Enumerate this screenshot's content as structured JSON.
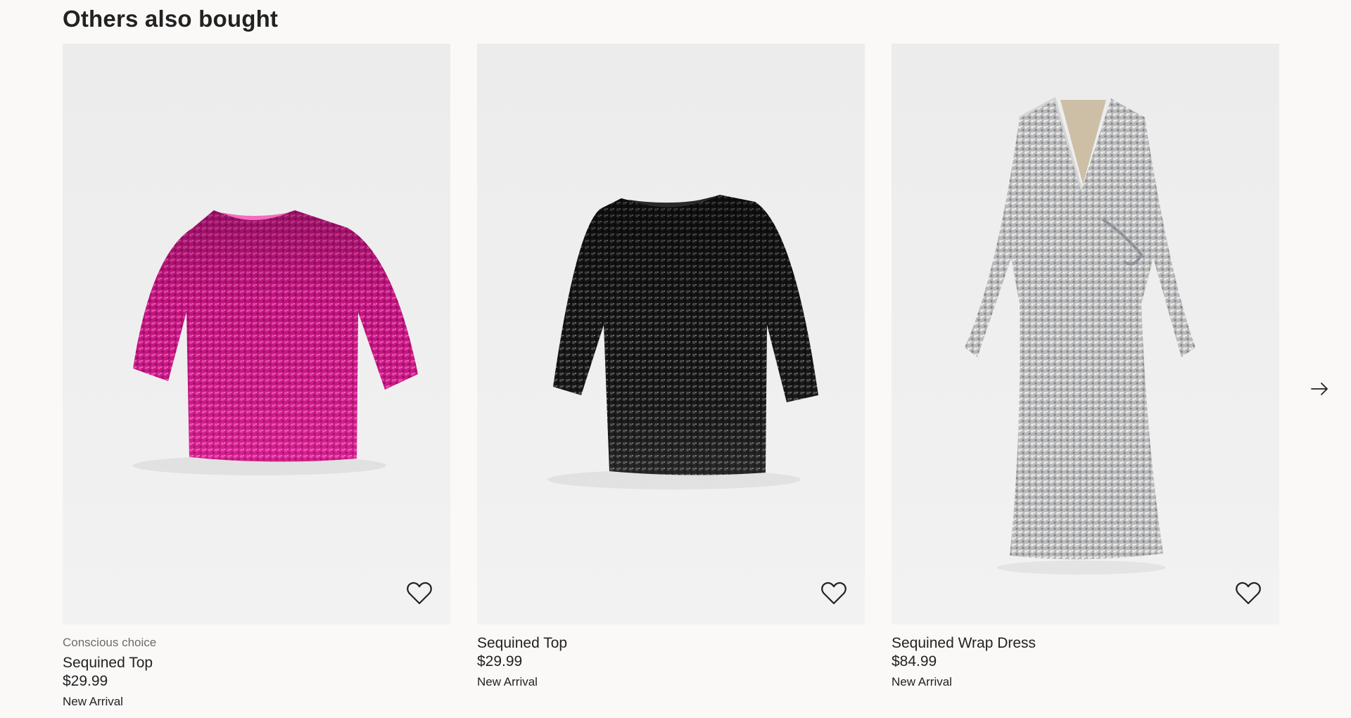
{
  "section": {
    "title": "Others also bought"
  },
  "products": [
    {
      "tag": "Conscious choice",
      "name": "Sequined Top",
      "price": "$29.99",
      "badge": "New Arrival",
      "color": "#d21a8c"
    },
    {
      "tag": "",
      "name": "Sequined Top",
      "price": "$29.99",
      "badge": "New Arrival",
      "color": "#1c1c1c"
    },
    {
      "tag": "",
      "name": "Sequined Wrap Dress",
      "price": "$84.99",
      "badge": "New Arrival",
      "color": "#c9c9c9"
    }
  ],
  "icons": {
    "favorite": "heart-outline-icon",
    "next": "arrow-right-icon"
  }
}
